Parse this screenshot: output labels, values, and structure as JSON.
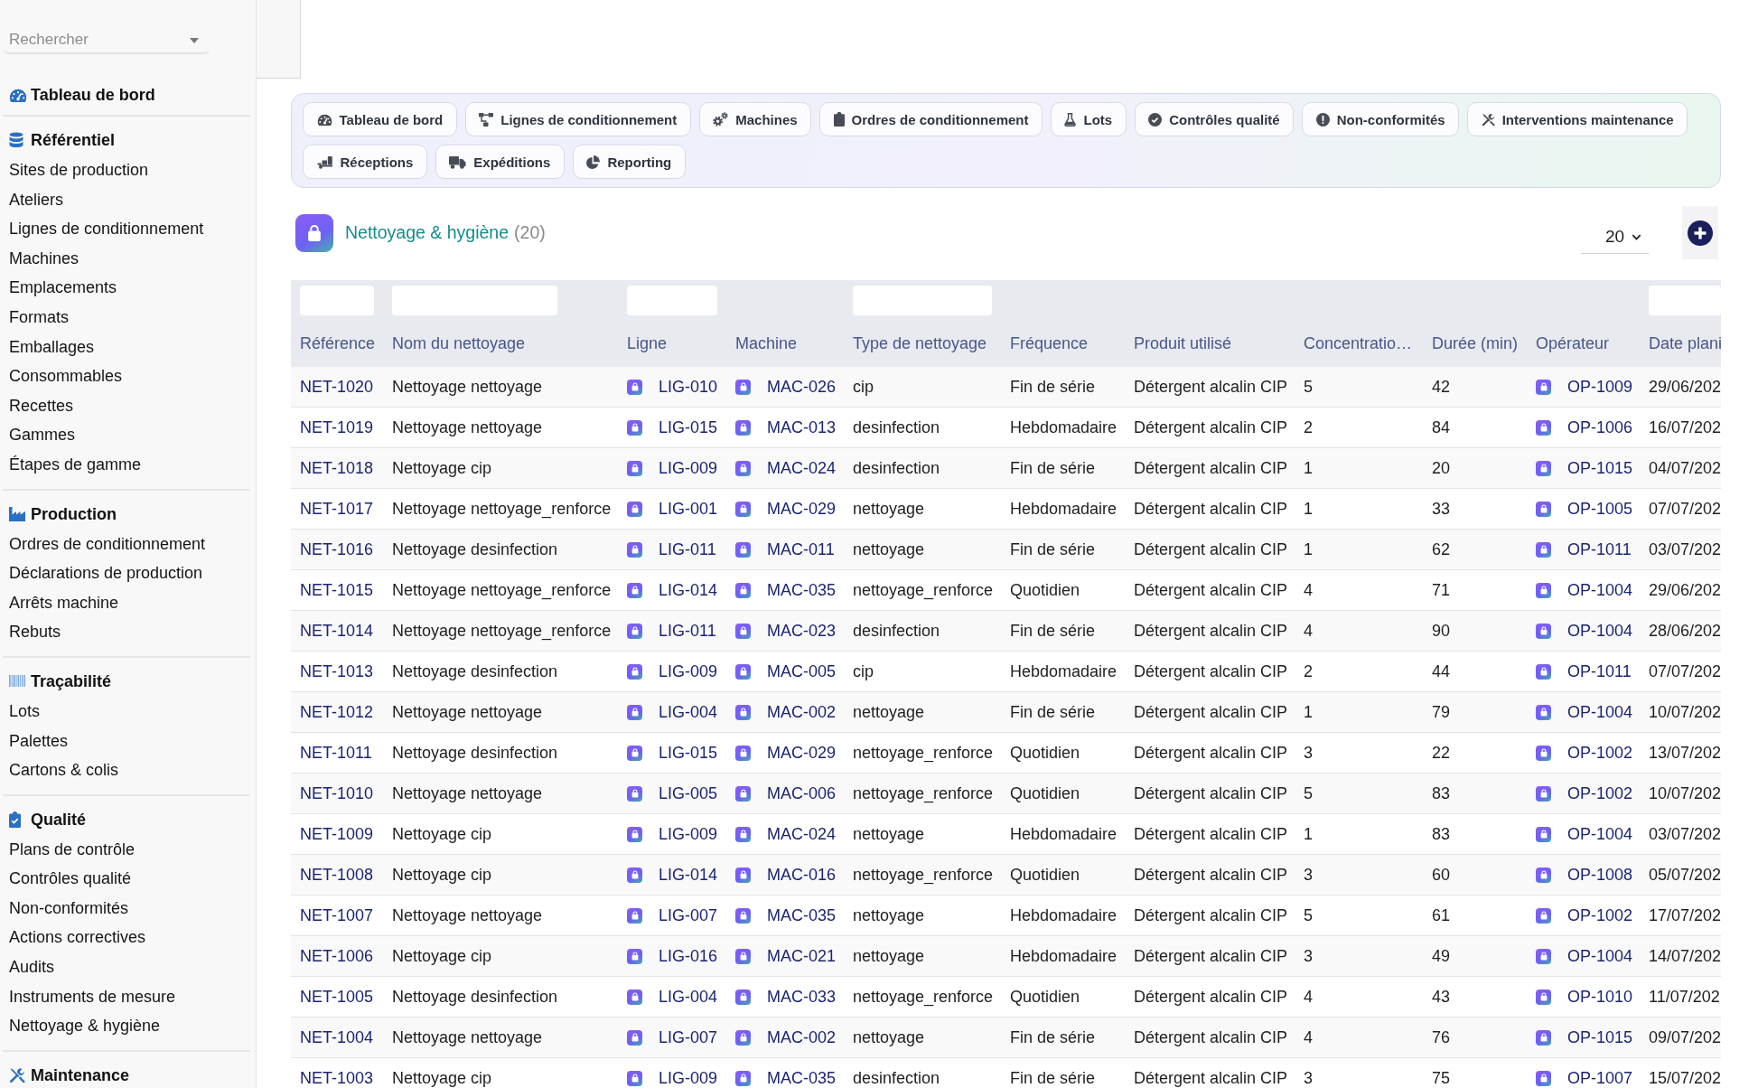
{
  "sidebar": {
    "search": {
      "placeholder": "Rechercher"
    },
    "sections": [
      {
        "title": "Tableau de bord"
      },
      {
        "title": "Référentiel",
        "items": [
          "Sites de production",
          "Ateliers",
          "Lignes de conditionnement",
          "Machines",
          "Emplacements",
          "Formats",
          "Emballages",
          "Consommables",
          "Recettes",
          "Gammes",
          "Étapes de gamme"
        ]
      },
      {
        "title": "Production",
        "items": [
          "Ordres de conditionnement",
          "Déclarations de production",
          "Arrêts machine",
          "Rebuts"
        ]
      },
      {
        "title": "Traçabilité",
        "items": [
          "Lots",
          "Palettes",
          "Cartons & colis"
        ]
      },
      {
        "title": "Qualité",
        "items": [
          "Plans de contrôle",
          "Contrôles qualité",
          "Non-conformités",
          "Actions correctives",
          "Audits",
          "Instruments de mesure",
          "Nettoyage & hygiène"
        ]
      },
      {
        "title": "Maintenance"
      }
    ]
  },
  "nav_tabs": [
    [
      "Tableau de bord",
      "Lignes de conditionnement",
      "Machines",
      "Ordres de conditionnement",
      "Lots",
      "Contrôles qualité",
      "Non-conformités",
      "Interventions maintenance"
    ],
    [
      "Réceptions",
      "Expéditions",
      "Reporting"
    ]
  ],
  "page_header": {
    "title": "Nettoyage & hygiène",
    "count": "(20)",
    "page_size": "20"
  },
  "table": {
    "columns": [
      {
        "label": "Référence",
        "kind": "link",
        "filter": true
      },
      {
        "label": "Nom du nettoyage",
        "kind": "text",
        "filter": true
      },
      {
        "label": "Ligne",
        "kind": "icon_link",
        "filter": true
      },
      {
        "label": "Machine",
        "kind": "icon_link",
        "filter": false
      },
      {
        "label": "Type de nettoyage",
        "kind": "text",
        "filter": true
      },
      {
        "label": "Fréquence",
        "kind": "text",
        "filter": false
      },
      {
        "label": "Produit utilisé",
        "kind": "text",
        "filter": false
      },
      {
        "label": "Concentratio…",
        "kind": "text",
        "filter": false
      },
      {
        "label": "Durée (min)",
        "kind": "text",
        "filter": false
      },
      {
        "label": "Opérateur",
        "kind": "icon_link",
        "filter": false
      },
      {
        "label": "Date plani",
        "kind": "text",
        "filter": true
      }
    ],
    "rows": [
      [
        "NET-1020",
        "Nettoyage nettoyage",
        "LIG-010",
        "MAC-026",
        "cip",
        "Fin de série",
        "Détergent alcalin CIP",
        "5",
        "42",
        "OP-1009",
        "29/06/202"
      ],
      [
        "NET-1019",
        "Nettoyage nettoyage",
        "LIG-015",
        "MAC-013",
        "desinfection",
        "Hebdomadaire",
        "Détergent alcalin CIP",
        "2",
        "84",
        "OP-1006",
        "16/07/202"
      ],
      [
        "NET-1018",
        "Nettoyage cip",
        "LIG-009",
        "MAC-024",
        "desinfection",
        "Fin de série",
        "Détergent alcalin CIP",
        "1",
        "20",
        "OP-1015",
        "04/07/202"
      ],
      [
        "NET-1017",
        "Nettoyage nettoyage_renforce",
        "LIG-001",
        "MAC-029",
        "nettoyage",
        "Hebdomadaire",
        "Détergent alcalin CIP",
        "1",
        "33",
        "OP-1005",
        "07/07/202"
      ],
      [
        "NET-1016",
        "Nettoyage desinfection",
        "LIG-011",
        "MAC-011",
        "nettoyage",
        "Fin de série",
        "Détergent alcalin CIP",
        "1",
        "62",
        "OP-1011",
        "03/07/202"
      ],
      [
        "NET-1015",
        "Nettoyage nettoyage_renforce",
        "LIG-014",
        "MAC-035",
        "nettoyage_renforce",
        "Quotidien",
        "Détergent alcalin CIP",
        "4",
        "71",
        "OP-1004",
        "29/06/202"
      ],
      [
        "NET-1014",
        "Nettoyage nettoyage_renforce",
        "LIG-011",
        "MAC-023",
        "desinfection",
        "Fin de série",
        "Détergent alcalin CIP",
        "4",
        "90",
        "OP-1004",
        "28/06/202"
      ],
      [
        "NET-1013",
        "Nettoyage desinfection",
        "LIG-009",
        "MAC-005",
        "cip",
        "Hebdomadaire",
        "Détergent alcalin CIP",
        "2",
        "44",
        "OP-1011",
        "07/07/202"
      ],
      [
        "NET-1012",
        "Nettoyage nettoyage",
        "LIG-004",
        "MAC-002",
        "nettoyage",
        "Fin de série",
        "Détergent alcalin CIP",
        "1",
        "79",
        "OP-1004",
        "10/07/202"
      ],
      [
        "NET-1011",
        "Nettoyage desinfection",
        "LIG-015",
        "MAC-029",
        "nettoyage_renforce",
        "Quotidien",
        "Détergent alcalin CIP",
        "3",
        "22",
        "OP-1002",
        "13/07/202"
      ],
      [
        "NET-1010",
        "Nettoyage nettoyage",
        "LIG-005",
        "MAC-006",
        "nettoyage_renforce",
        "Quotidien",
        "Détergent alcalin CIP",
        "5",
        "83",
        "OP-1002",
        "10/07/202"
      ],
      [
        "NET-1009",
        "Nettoyage cip",
        "LIG-009",
        "MAC-024",
        "nettoyage",
        "Hebdomadaire",
        "Détergent alcalin CIP",
        "1",
        "83",
        "OP-1004",
        "03/07/202"
      ],
      [
        "NET-1008",
        "Nettoyage cip",
        "LIG-014",
        "MAC-016",
        "nettoyage_renforce",
        "Quotidien",
        "Détergent alcalin CIP",
        "3",
        "60",
        "OP-1008",
        "05/07/202"
      ],
      [
        "NET-1007",
        "Nettoyage nettoyage",
        "LIG-007",
        "MAC-035",
        "nettoyage",
        "Hebdomadaire",
        "Détergent alcalin CIP",
        "5",
        "61",
        "OP-1002",
        "17/07/202"
      ],
      [
        "NET-1006",
        "Nettoyage cip",
        "LIG-016",
        "MAC-021",
        "nettoyage",
        "Hebdomadaire",
        "Détergent alcalin CIP",
        "3",
        "49",
        "OP-1004",
        "14/07/202"
      ],
      [
        "NET-1005",
        "Nettoyage desinfection",
        "LIG-004",
        "MAC-033",
        "nettoyage_renforce",
        "Quotidien",
        "Détergent alcalin CIP",
        "4",
        "43",
        "OP-1010",
        "11/07/202"
      ],
      [
        "NET-1004",
        "Nettoyage nettoyage",
        "LIG-007",
        "MAC-002",
        "nettoyage",
        "Fin de série",
        "Détergent alcalin CIP",
        "4",
        "76",
        "OP-1015",
        "09/07/202"
      ],
      [
        "NET-1003",
        "Nettoyage cip",
        "LIG-009",
        "MAC-035",
        "desinfection",
        "Fin de série",
        "Détergent alcalin CIP",
        "3",
        "75",
        "OP-1007",
        "15/07/202"
      ]
    ]
  }
}
